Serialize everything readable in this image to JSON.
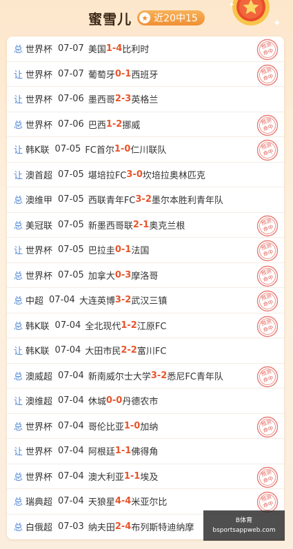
{
  "header": {
    "title": "蜜雪儿",
    "badge_text": "近20中15"
  },
  "stamp_text": [
    "预测",
    "命中"
  ],
  "rows": [
    {
      "type": "总",
      "league": "世界杯",
      "date": "07-07",
      "home": "美国",
      "hs": "1",
      "as": "4",
      "away": "比利时",
      "hit": true
    },
    {
      "type": "让",
      "league": "世界杯",
      "date": "07-07",
      "home": "葡萄牙",
      "hs": "0",
      "as": "1",
      "away": "西班牙",
      "hit": true
    },
    {
      "type": "让",
      "league": "世界杯",
      "date": "07-06",
      "home": "墨西哥",
      "hs": "2",
      "as": "3",
      "away": "英格兰",
      "hit": false
    },
    {
      "type": "总",
      "league": "世界杯",
      "date": "07-06",
      "home": "巴西",
      "hs": "1",
      "as": "2",
      "away": "挪威",
      "hit": true
    },
    {
      "type": "让",
      "league": "韩K联",
      "date": "07-05",
      "home": "FC首尔",
      "hs": "1",
      "as": "0",
      "away": "仁川联队",
      "hit": true
    },
    {
      "type": "让",
      "league": "澳首超",
      "date": "07-05",
      "home": "堪培拉FC",
      "hs": "3",
      "as": "0",
      "away": "坎培拉奥林匹克",
      "hit": false
    },
    {
      "type": "总",
      "league": "澳维甲",
      "date": "07-05",
      "home": "西联青年FC",
      "hs": "3",
      "as": "2",
      "away": "墨尔本胜利青年队",
      "hit": false
    },
    {
      "type": "总",
      "league": "美冠联",
      "date": "07-05",
      "home": "新墨西哥联",
      "hs": "2",
      "as": "1",
      "away": "奥克兰根",
      "hit": true
    },
    {
      "type": "让",
      "league": "世界杯",
      "date": "07-05",
      "home": "巴拉圭",
      "hs": "0",
      "as": "1",
      "away": "法国",
      "hit": true
    },
    {
      "type": "总",
      "league": "世界杯",
      "date": "07-05",
      "home": "加拿大",
      "hs": "0",
      "as": "3",
      "away": "摩洛哥",
      "hit": true
    },
    {
      "type": "总",
      "league": "中超",
      "date": "07-04",
      "home": "大连英博",
      "hs": "3",
      "as": "2",
      "away": "武汉三镇",
      "hit": true
    },
    {
      "type": "总",
      "league": "韩K联",
      "date": "07-04",
      "home": "全北现代",
      "hs": "1",
      "as": "2",
      "away": "江原FC",
      "hit": true
    },
    {
      "type": "让",
      "league": "韩K联",
      "date": "07-04",
      "home": "大田市民",
      "hs": "2",
      "as": "2",
      "away": "富川FC",
      "hit": false
    },
    {
      "type": "总",
      "league": "澳威超",
      "date": "07-04",
      "home": "新南威尔士大学",
      "hs": "3",
      "as": "2",
      "away": "悉尼FC青年队",
      "hit": true
    },
    {
      "type": "让",
      "league": "澳维超",
      "date": "07-04",
      "home": "休城",
      "hs": "0",
      "as": "0",
      "away": "丹德农市",
      "hit": false
    },
    {
      "type": "总",
      "league": "世界杯",
      "date": "07-04",
      "home": "哥伦比亚",
      "hs": "1",
      "as": "0",
      "away": "加纳",
      "hit": true
    },
    {
      "type": "让",
      "league": "世界杯",
      "date": "07-04",
      "home": "阿根廷",
      "hs": "1",
      "as": "1",
      "away": "佛得角",
      "hit": false
    },
    {
      "type": "总",
      "league": "世界杯",
      "date": "07-04",
      "home": "澳大利亚",
      "hs": "1",
      "as": "1",
      "away": "埃及",
      "hit": true
    },
    {
      "type": "总",
      "league": "瑞典超",
      "date": "07-04",
      "home": "天狼星",
      "hs": "4",
      "as": "4",
      "away": "米亚尔比",
      "hit": true
    },
    {
      "type": "总",
      "league": "白俄超",
      "date": "07-03",
      "home": "纳夫田",
      "hs": "2",
      "as": "4",
      "away": "布列斯特迪纳摩",
      "hit": false
    }
  ],
  "watermark": {
    "line1": "B体育",
    "line2": "bsportsappweb.com"
  },
  "colors": {
    "accent": "#e8542a",
    "type_blue": "#4f86d6",
    "badge": "#ef9033"
  }
}
